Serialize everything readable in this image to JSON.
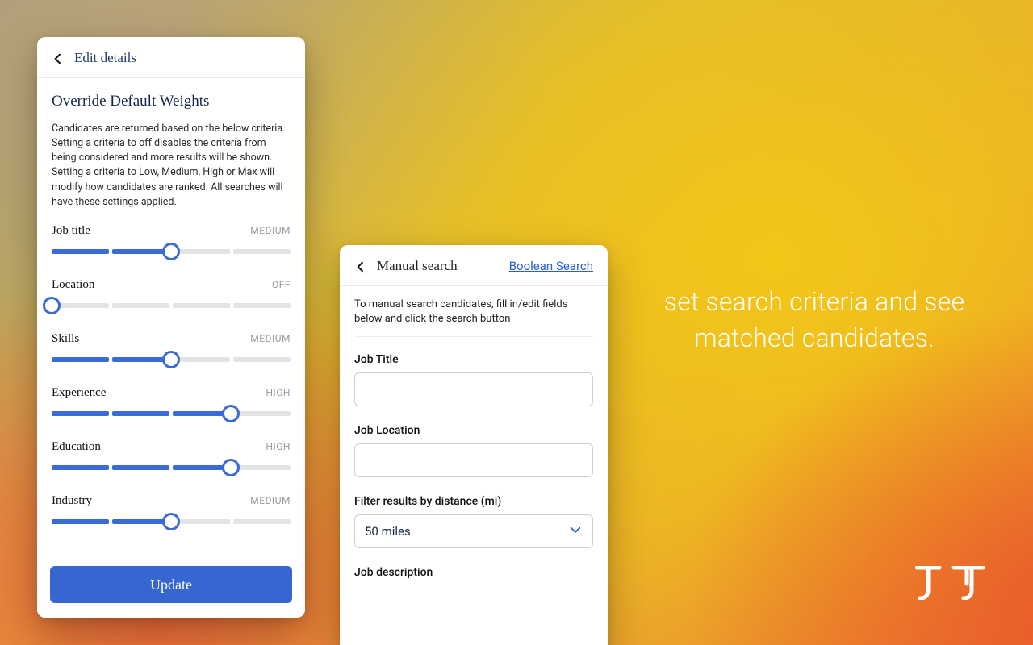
{
  "card1": {
    "header_title": "Edit details",
    "heading": "Override Default Weights",
    "description": "Candidates are returned based on the below criteria. Setting a criteria to off disables the criteria from being considered and more results will be shown. Setting a criteria to Low, Medium, High or Max will modify how candidates are ranked. All searches will have these settings applied.",
    "criteria": [
      {
        "label": "Job title",
        "level": "MEDIUM",
        "value": 2
      },
      {
        "label": "Location",
        "level": "OFF",
        "value": 0
      },
      {
        "label": "Skills",
        "level": "MEDIUM",
        "value": 2
      },
      {
        "label": "Experience",
        "level": "HIGH",
        "value": 3
      },
      {
        "label": "Education",
        "level": "HIGH",
        "value": 3
      },
      {
        "label": "Industry",
        "level": "MEDIUM",
        "value": 2
      }
    ],
    "update_label": "Update"
  },
  "card2": {
    "header_title": "Manual search",
    "boolean_link": "Boolean Search",
    "description": "To manual search candidates, fill in/edit fields below and click the search button",
    "fields": {
      "job_title_label": "Job Title",
      "job_location_label": "Job Location",
      "distance_label": "Filter results by distance (mi)",
      "distance_value": "50 miles",
      "job_desc_label": "Job description"
    }
  },
  "headline": "set search criteria and see matched candidates."
}
